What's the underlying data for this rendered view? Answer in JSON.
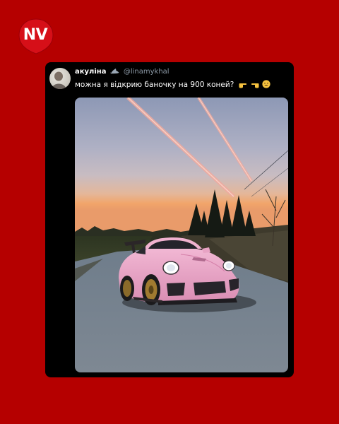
{
  "brand": {
    "logo_text": "NV"
  },
  "tweet": {
    "display_name": "акуліна",
    "handle": "@linamykhal",
    "text": "можна я відкрию баночку на 900 коней?",
    "emojis": [
      "point-right-hand",
      "point-left-hand",
      "grinning-face"
    ]
  },
  "colors": {
    "background": "#b50000",
    "card": "#000000",
    "handle": "#8b98a5",
    "car": "#e8a3c4"
  }
}
